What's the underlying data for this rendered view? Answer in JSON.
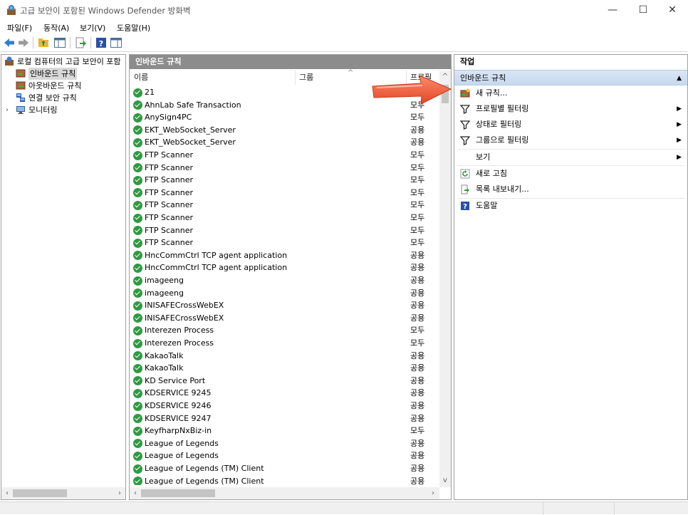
{
  "window": {
    "title": "고급 보안이 포함된 Windows Defender 방화벽",
    "minimize": "—",
    "maximize": "☐",
    "close": "✕"
  },
  "menu": [
    "파일(F)",
    "동작(A)",
    "보기(V)",
    "도움말(H)"
  ],
  "tree": {
    "root": "로컬 컴퓨터의 고급 보안이 포함",
    "items": [
      {
        "label": "인바운드 규칙",
        "selected": true,
        "icon": "inbound-rules-icon"
      },
      {
        "label": "아웃바운드 규칙",
        "selected": false,
        "icon": "outbound-rules-icon"
      },
      {
        "label": "연결 보안 규칙",
        "selected": false,
        "icon": "connection-security-icon"
      },
      {
        "label": "모니터링",
        "selected": false,
        "icon": "monitoring-icon"
      }
    ]
  },
  "list": {
    "title": "인바운드 규칙",
    "columns": {
      "name": "이름",
      "group": "그룹",
      "profile": "프로필"
    },
    "rows": [
      {
        "name": "21",
        "profile": ""
      },
      {
        "name": "AhnLab Safe Transaction",
        "profile": "모두"
      },
      {
        "name": "AnySign4PC",
        "profile": "모두"
      },
      {
        "name": "EKT_WebSocket_Server",
        "profile": "공용"
      },
      {
        "name": "EKT_WebSocket_Server",
        "profile": "공용"
      },
      {
        "name": "FTP Scanner",
        "profile": "모두"
      },
      {
        "name": "FTP Scanner",
        "profile": "모두"
      },
      {
        "name": "FTP Scanner",
        "profile": "모두"
      },
      {
        "name": "FTP Scanner",
        "profile": "모두"
      },
      {
        "name": "FTP Scanner",
        "profile": "모두"
      },
      {
        "name": "FTP Scanner",
        "profile": "모두"
      },
      {
        "name": "FTP Scanner",
        "profile": "모두"
      },
      {
        "name": "FTP Scanner",
        "profile": "모두"
      },
      {
        "name": "HncCommCtrl TCP agent application",
        "profile": "공용"
      },
      {
        "name": "HncCommCtrl TCP agent application",
        "profile": "공용"
      },
      {
        "name": "imageeng",
        "profile": "공용"
      },
      {
        "name": "imageeng",
        "profile": "공용"
      },
      {
        "name": "INISAFECrossWebEX",
        "profile": "공용"
      },
      {
        "name": "INISAFECrossWebEX",
        "profile": "공용"
      },
      {
        "name": "Interezen Process",
        "profile": "모두"
      },
      {
        "name": "Interezen Process",
        "profile": "모두"
      },
      {
        "name": "KakaoTalk",
        "profile": "공용"
      },
      {
        "name": "KakaoTalk",
        "profile": "공용"
      },
      {
        "name": "KD Service Port",
        "profile": "공용"
      },
      {
        "name": "KDSERVICE 9245",
        "profile": "공용"
      },
      {
        "name": "KDSERVICE 9246",
        "profile": "공용"
      },
      {
        "name": "KDSERVICE 9247",
        "profile": "공용"
      },
      {
        "name": "KeyfharpNxBiz-in",
        "profile": "모두"
      },
      {
        "name": "League of Legends",
        "profile": "공용"
      },
      {
        "name": "League of Legends",
        "profile": "공용"
      },
      {
        "name": "League of Legends (TM) Client",
        "profile": "공용"
      },
      {
        "name": "League of Legends (TM) Client",
        "profile": "공용"
      }
    ]
  },
  "actions": {
    "title": "작업",
    "section": "인바운드 규칙",
    "items": [
      {
        "label": "새 규칙...",
        "icon": "new-rule-icon",
        "submenu": false
      },
      {
        "label": "프로필별 필터링",
        "icon": "filter-icon",
        "submenu": true
      },
      {
        "label": "상태로 필터링",
        "icon": "filter-icon",
        "submenu": true
      },
      {
        "label": "그룹으로 필터링",
        "icon": "filter-icon",
        "submenu": true
      },
      {
        "label": "보기",
        "icon": "",
        "submenu": true
      },
      {
        "label": "새로 고침",
        "icon": "refresh-icon",
        "submenu": false
      },
      {
        "label": "목록 내보내기...",
        "icon": "export-icon",
        "submenu": false
      },
      {
        "label": "도움말",
        "icon": "help-icon",
        "submenu": false
      }
    ]
  },
  "colors": {
    "check_green": "#2f9a41",
    "header_gray": "#8c8c8c",
    "section_blue": "#c7d9ee",
    "annotation_arrow": "#f06a45"
  }
}
